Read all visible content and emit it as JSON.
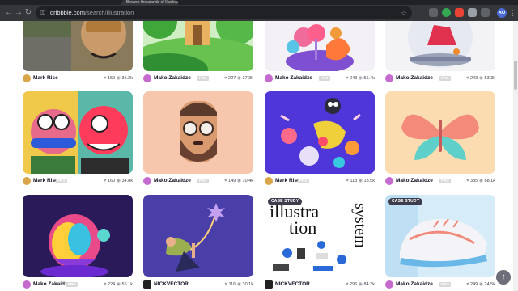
{
  "browser": {
    "tab_title": "Browse thousands of Illustration",
    "url_host": "dribbble.com",
    "url_path": "/search/illustration",
    "profile_initials": "AO"
  },
  "stats_icons": {
    "likes": "heart-icon",
    "views": "eye-icon"
  },
  "pro_label": "PRO",
  "case_study_label": "CASE STUDY",
  "scroll_top_icon": "arrow-up-icon",
  "shots": [
    {
      "author": "Mark Rise",
      "pro": false,
      "likes": "159",
      "views": "35.2k",
      "badge": ""
    },
    {
      "author": "Mako Zakaidze",
      "pro": true,
      "likes": "227",
      "views": "37.3k",
      "badge": ""
    },
    {
      "author": "Mako Zakaidze",
      "pro": true,
      "likes": "243",
      "views": "55.4k",
      "badge": ""
    },
    {
      "author": "Mako Zakaidze",
      "pro": true,
      "likes": "243",
      "views": "53.3k",
      "badge": ""
    },
    {
      "author": "Mark Rise",
      "pro": true,
      "likes": "160",
      "views": "34.8k",
      "badge": ""
    },
    {
      "author": "Mako Zakaidze",
      "pro": true,
      "likes": "149",
      "views": "10.4k",
      "badge": ""
    },
    {
      "author": "Mark Rise",
      "pro": true,
      "likes": "118",
      "views": "13.5k",
      "badge": ""
    },
    {
      "author": "Mako Zakaidze",
      "pro": true,
      "likes": "335",
      "views": "68.1k",
      "badge": ""
    },
    {
      "author": "Mako Zakaidze",
      "pro": true,
      "likes": "224",
      "views": "56.1k",
      "badge": ""
    },
    {
      "author": "NICKVECTOR",
      "pro": false,
      "likes": "116",
      "views": "30.1k",
      "badge": ""
    },
    {
      "author": "NICKVECTOR",
      "pro": false,
      "likes": "296",
      "views": "84.3k",
      "badge": "CASE STUDY",
      "art_text": [
        "illustra",
        "tion",
        "system"
      ]
    },
    {
      "author": "Mako Zakaidze",
      "pro": true,
      "likes": "249",
      "views": "24.5k",
      "badge": "CASE STUDY"
    }
  ]
}
